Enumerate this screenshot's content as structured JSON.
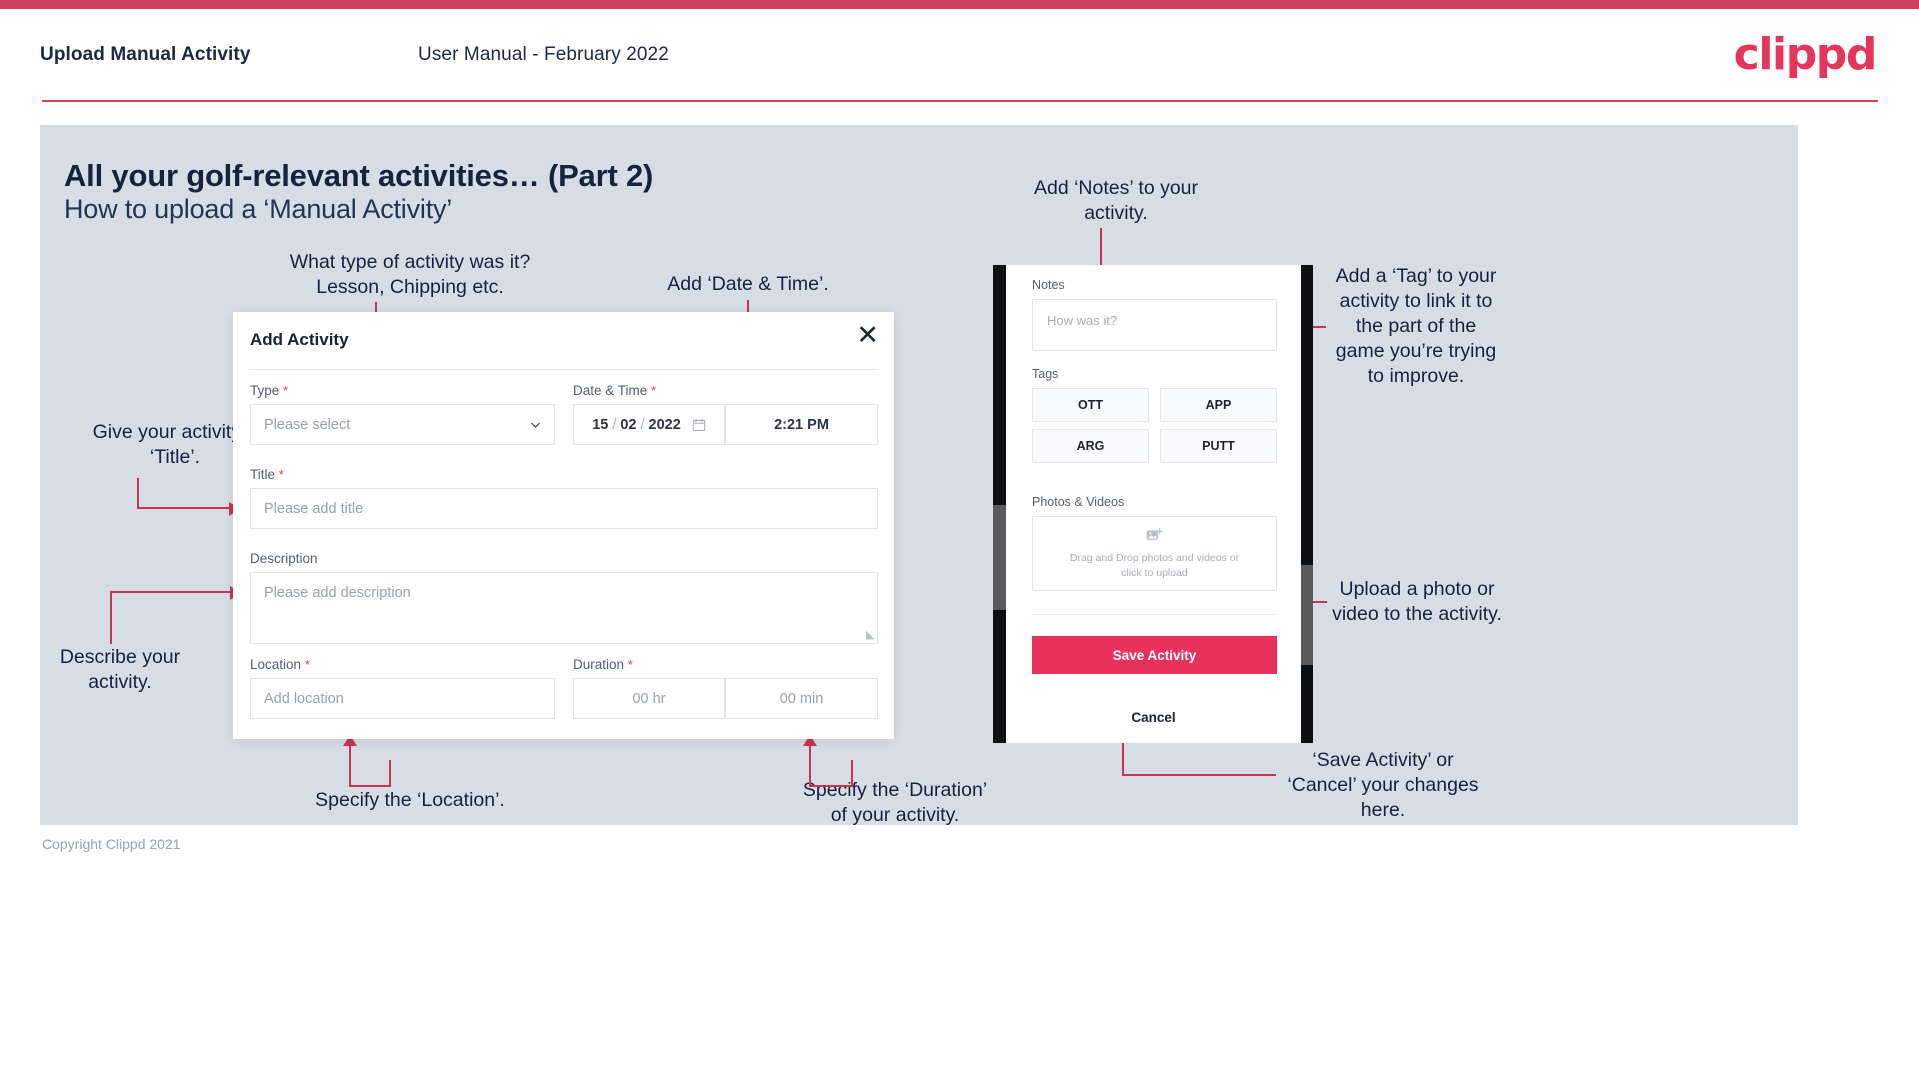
{
  "header": {
    "title": "Upload Manual Activity",
    "subtitle": "User Manual - February 2022",
    "logo": "clippd"
  },
  "slide": {
    "title": "All your golf-relevant activities… (Part 2)",
    "subtitle": "How to upload a ‘Manual Activity’",
    "copyright": "Copyright Clippd 2021"
  },
  "annotations": {
    "type": "What type of activity was it?\nLesson, Chipping etc.",
    "date_time": "Add ‘Date & Time’.",
    "title": "Give your activity a\n‘Title’.",
    "description": "Describe your\nactivity.",
    "location": "Specify the ‘Location’.",
    "duration": "Specify the ‘Duration’\nof your activity.",
    "notes": "Add ‘Notes’ to your\nactivity.",
    "tag": "Add a ‘Tag’ to your\nactivity to link it to\nthe part of the\ngame you’re trying\nto improve.",
    "upload": "Upload a photo or\nvideo to the activity.",
    "save_cancel": "‘Save Activity’ or\n‘Cancel’ your changes\nhere."
  },
  "dialog": {
    "title": "Add Activity",
    "close_icon": "close-icon",
    "fields": {
      "type": {
        "label": "Type",
        "required": "*",
        "placeholder": "Please select",
        "chevron_icon": "chevron-down-icon"
      },
      "datetime": {
        "label": "Date & Time",
        "required": "*",
        "day": "15",
        "sep1": "/",
        "month": "02",
        "sep2": "/",
        "year": "2022",
        "calendar_icon": "calendar-icon",
        "time": "2:21 PM"
      },
      "title": {
        "label": "Title",
        "required": "*",
        "placeholder": "Please add title"
      },
      "description": {
        "label": "Description",
        "required": "",
        "placeholder": "Please add description"
      },
      "location": {
        "label": "Location",
        "required": "*",
        "placeholder": "Add location"
      },
      "duration": {
        "label": "Duration",
        "required": "*",
        "hours_placeholder": "00 hr",
        "minutes_placeholder": "00 min"
      }
    }
  },
  "phone": {
    "notes_label": "Notes",
    "notes_placeholder": "How was it?",
    "tags_label": "Tags",
    "tags": [
      "OTT",
      "APP",
      "ARG",
      "PUTT"
    ],
    "photos_label": "Photos & Videos",
    "dropzone_icon": "add-image-icon",
    "dropzone_text_line1": "Drag and Drop photos and videos or",
    "dropzone_text_line2": "click to upload",
    "save_label": "Save Activity",
    "cancel_label": "Cancel"
  },
  "colors": {
    "accent": "#e8315b",
    "header_rule": "#d1455f",
    "connector": "#ca3355",
    "slide_bg": "#d7dde5",
    "text_dark": "#16233d"
  }
}
